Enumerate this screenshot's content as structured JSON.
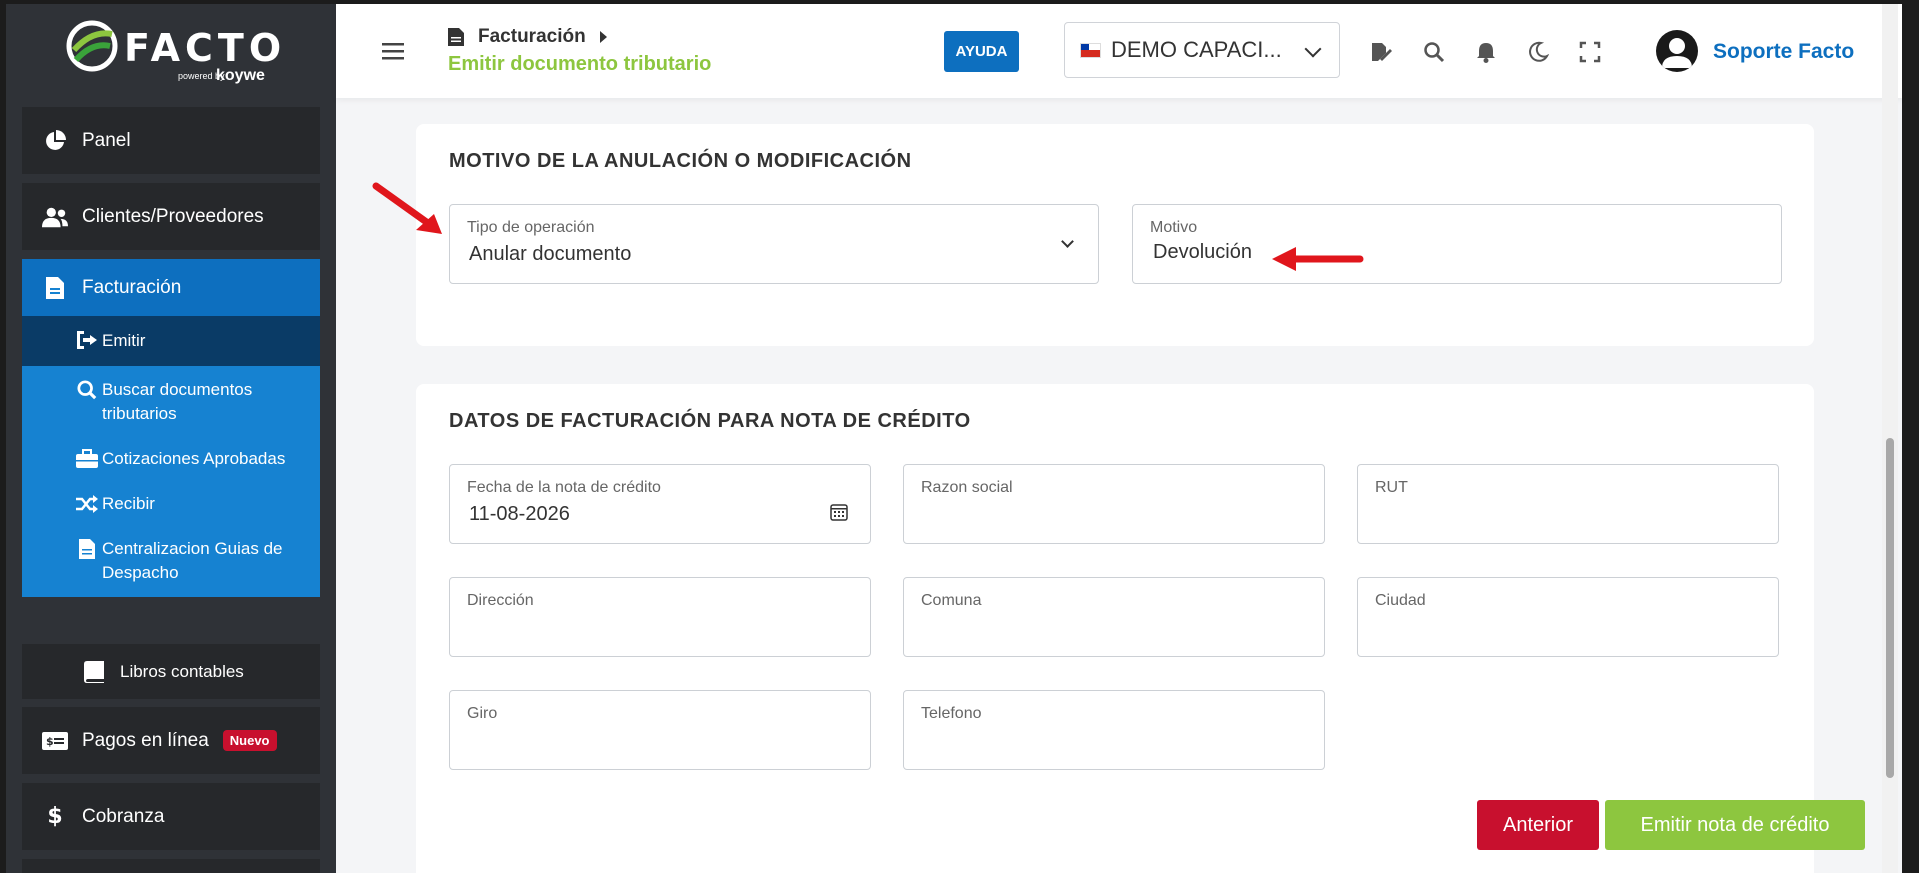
{
  "brand": {
    "name": "FACTO",
    "powered": "powered by",
    "partner": "koywe"
  },
  "sidebar": {
    "items": [
      {
        "label": "Panel",
        "icon": "pie-chart-icon"
      },
      {
        "label": "Clientes/Proveedores",
        "icon": "users-icon"
      },
      {
        "label": "Facturación",
        "icon": "file-icon"
      },
      {
        "label": "Pagos en línea",
        "icon": "money-icon",
        "badge": "Nuevo"
      },
      {
        "label": "Cobranza",
        "icon": "dollar-icon"
      }
    ],
    "submenu": [
      {
        "label": "Emitir",
        "icon": "sign-in-icon"
      },
      {
        "label": "Buscar documentos tributarios",
        "icon": "search-icon"
      },
      {
        "label": "Cotizaciones Aprobadas",
        "icon": "briefcase-icon"
      },
      {
        "label": "Recibir",
        "icon": "shuffle-icon"
      },
      {
        "label": "Centralizacion Guias de Despacho",
        "icon": "file-icon"
      }
    ],
    "libros": {
      "label": "Libros contables",
      "icon": "book-icon"
    }
  },
  "header": {
    "breadcrumb": "Facturación",
    "subtitle": "Emitir documento tributario",
    "help_label": "AYUDA",
    "company": "DEMO CAPACI...",
    "user": "Soporte Facto"
  },
  "motivo_card": {
    "title": "MOTIVO DE LA ANULACIÓN O MODIFICACIÓN",
    "tipo_label": "Tipo de operación",
    "tipo_value": "Anular documento",
    "motivo_label": "Motivo",
    "motivo_value": "Devolución"
  },
  "datos_card": {
    "title": "DATOS DE FACTURACIÓN PARA NOTA DE CRÉDITO",
    "fields": {
      "fecha_label": "Fecha de la nota de crédito",
      "fecha_value": "11-08-2026",
      "razon_label": "Razon social",
      "rut_label": "RUT",
      "direccion_label": "Dirección",
      "comuna_label": "Comuna",
      "ciudad_label": "Ciudad",
      "giro_label": "Giro",
      "telefono_label": "Telefono"
    },
    "prev_label": "Anterior",
    "emit_label": "Emitir nota de crédito"
  },
  "colors": {
    "primary": "#0d6fbf",
    "accent": "#8dc63f",
    "danger": "#c8102e",
    "sidebar": "#2f3237"
  }
}
